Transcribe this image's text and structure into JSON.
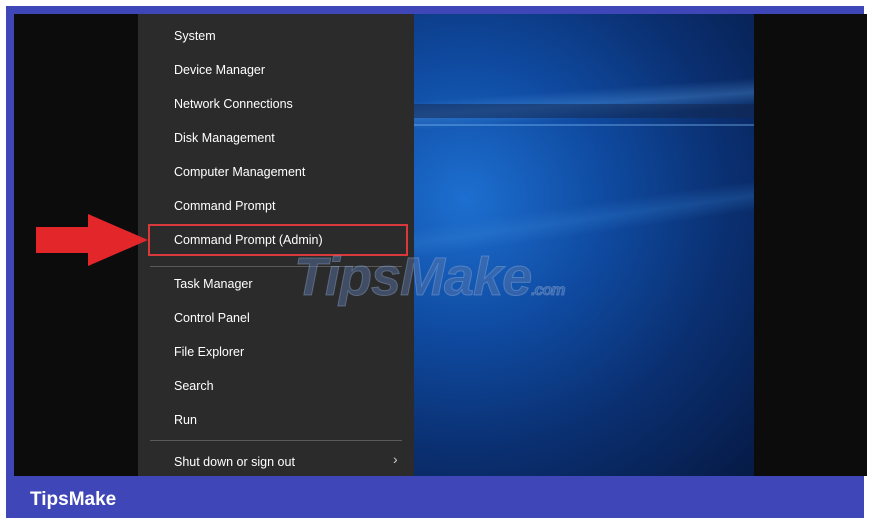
{
  "menu": {
    "items": [
      {
        "label": "System"
      },
      {
        "label": "Device Manager"
      },
      {
        "label": "Network Connections"
      },
      {
        "label": "Disk Management"
      },
      {
        "label": "Computer Management"
      },
      {
        "label": "Command Prompt"
      },
      {
        "label": "Command Prompt (Admin)"
      },
      {
        "label": "Task Manager"
      },
      {
        "label": "Control Panel"
      },
      {
        "label": "File Explorer"
      },
      {
        "label": "Search"
      },
      {
        "label": "Run"
      },
      {
        "label": "Shut down or sign out"
      }
    ],
    "submenu_icon": "chevron-right-icon",
    "highlight_color": "#d9393b"
  },
  "annotation": {
    "arrow_icon": "red-arrow-icon",
    "arrow_color": "#e3262a"
  },
  "watermark": {
    "text": "TipsMake",
    "suffix": ".com"
  },
  "footer": {
    "brand": "TipsMake"
  },
  "colors": {
    "frame": "#3f47b8",
    "menu_bg": "#2b2b2b"
  }
}
